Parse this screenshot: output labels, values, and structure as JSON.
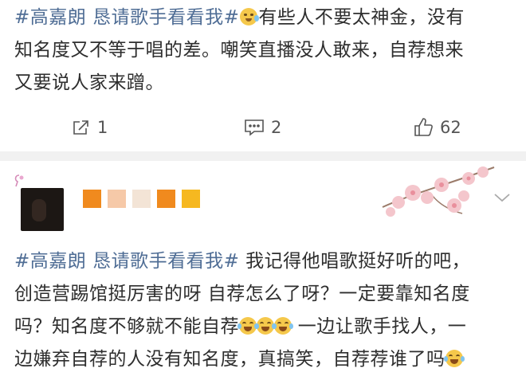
{
  "post": {
    "tag1": "#高嘉朗 恳请歌手看看我#",
    "emoji1": "crying-face-emoji",
    "line1_rest": "有些人不要太神金，没有",
    "line2": "知名度又不等于唱的差。嘲笑直播没人敢来，自荐想来",
    "line3": "又要说人家来蹭。"
  },
  "actions": {
    "repost_count": "1",
    "comment_count": "2",
    "like_count": "62"
  },
  "comment": {
    "tag1": "#高嘉朗 恳请歌手看看我#",
    "seg1": " 我记得他唱歌挺好听的吧，",
    "line2": "创造营踢馆挺厉害的呀 自荐怎么了呀？一定要靠知名度",
    "line3_pre": "吗？知名度不够就不能自荐",
    "line3_post": " 一边让歌手找人，一",
    "line4": "边嫌弃自荐的人没有知名度，真搞笑，自荐荐谁了吗",
    "emoji": "laughing-tears-emoji",
    "name_block_colors": [
      "#f08a1e",
      "#f6c9a8",
      "#f3e4d6",
      "#f08a1e",
      "#f6b820"
    ]
  }
}
